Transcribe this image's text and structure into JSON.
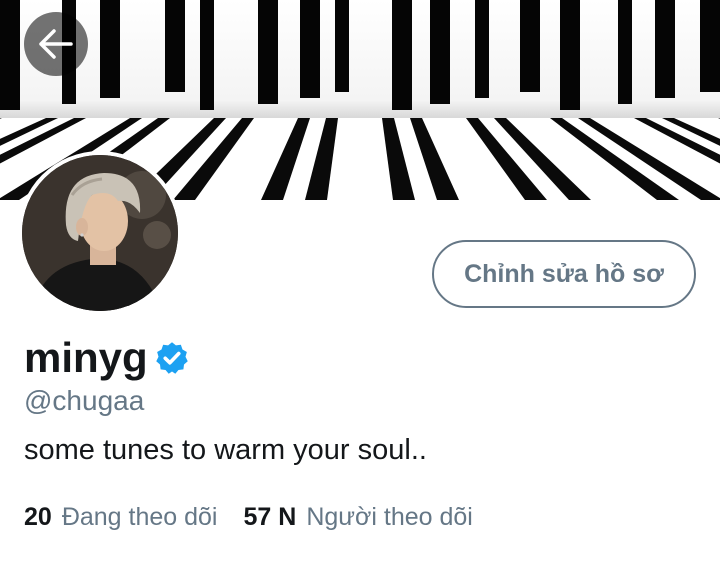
{
  "header": {
    "back_icon": "arrow-left-icon",
    "banner_description_icon": "piano-keys-image"
  },
  "profile": {
    "edit_button_label": "Chỉnh sửa hồ sơ",
    "display_name": "minyg",
    "verified_icon": "verified-badge-icon",
    "handle": "@chugaa",
    "bio": "some tunes to warm your soul.."
  },
  "stats": {
    "following_count": "20",
    "following_label": "Đang theo dõi",
    "followers_count": "57 N",
    "followers_label": "Người theo dõi"
  },
  "colors": {
    "text_primary": "#14171a",
    "text_secondary": "#657786",
    "verified_blue": "#1da1f2"
  }
}
